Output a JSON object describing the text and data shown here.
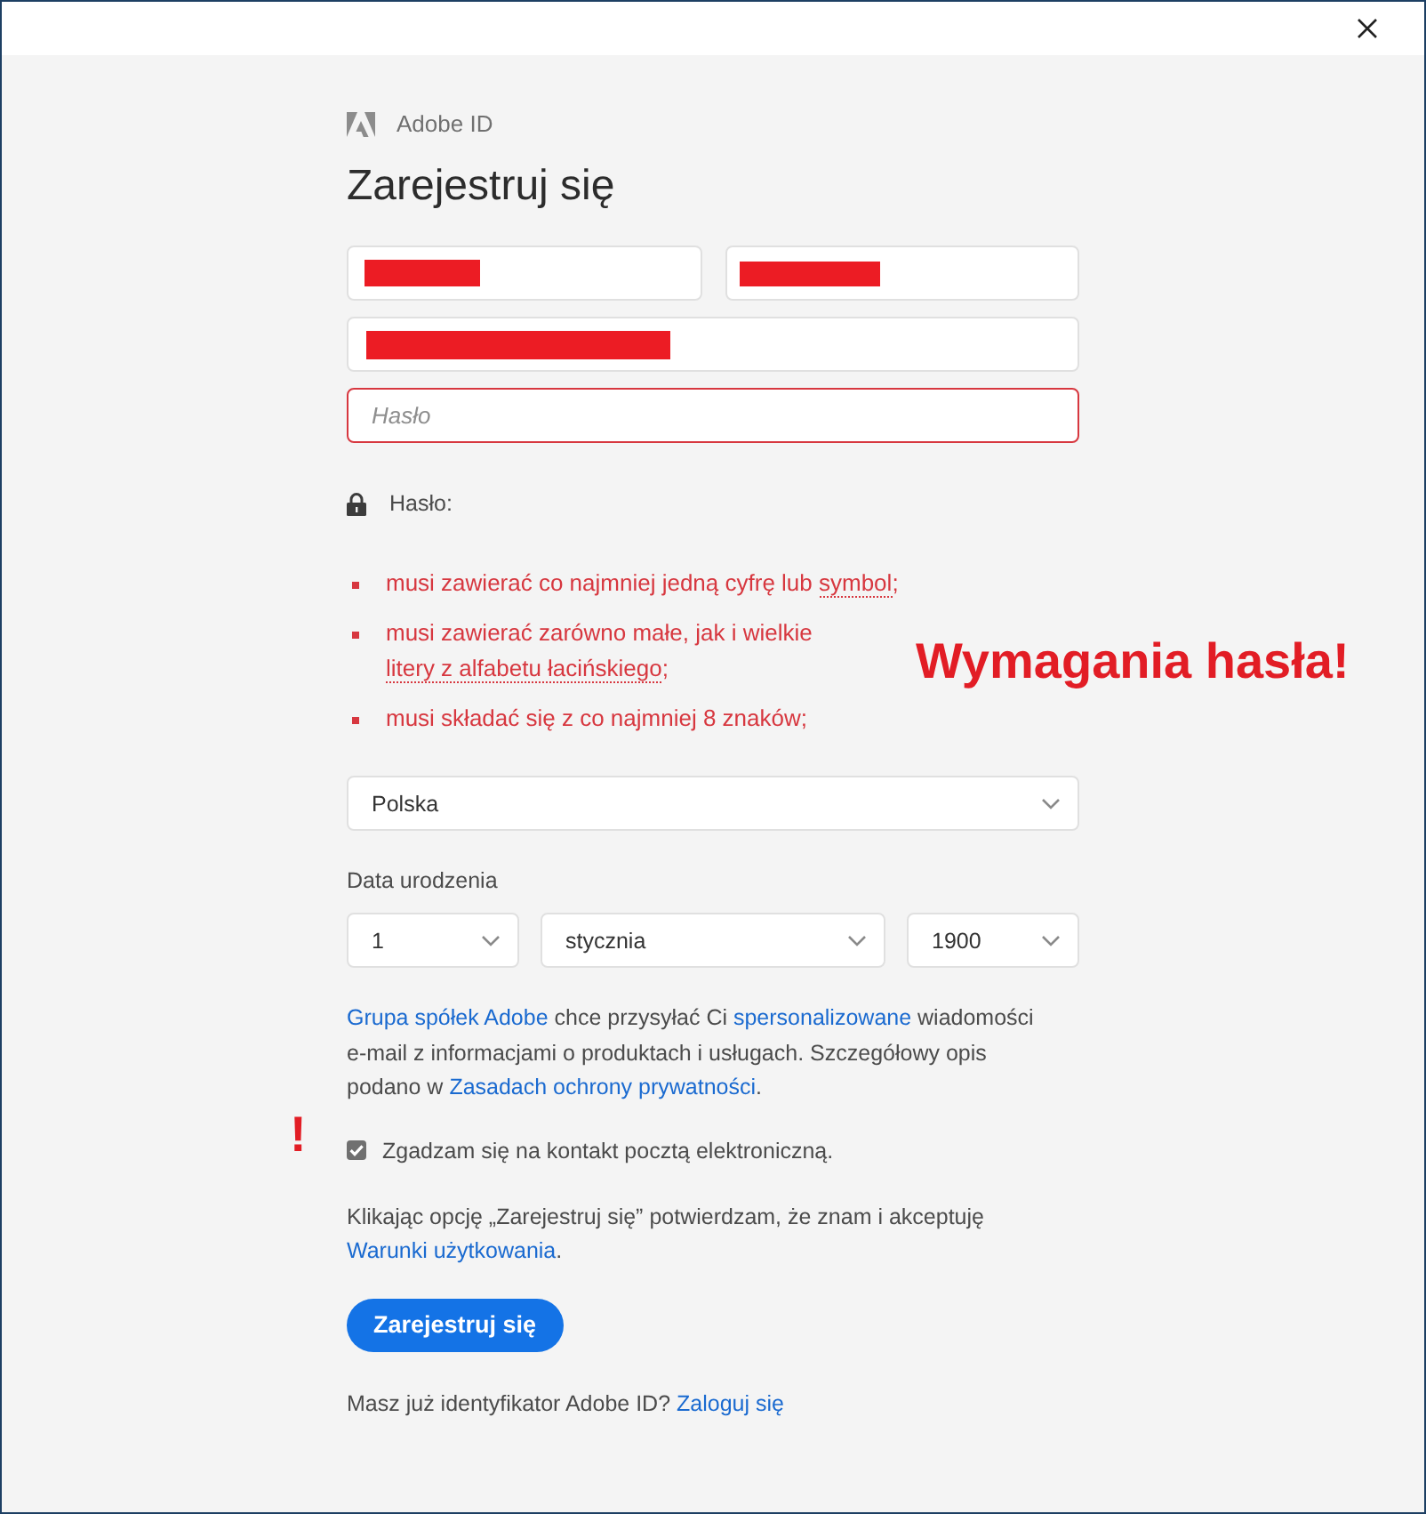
{
  "brand": {
    "name": "Adobe ID"
  },
  "title": "Zarejestruj się",
  "fields": [
    {
      "kind": "redacted"
    },
    {
      "kind": "redacted"
    },
    {
      "kind": "redacted"
    },
    {
      "kind": "password",
      "placeholder": "Hasło",
      "error": true
    }
  ],
  "password_rules": {
    "label": "Hasło:",
    "items": [
      {
        "met": false,
        "parts": [
          {
            "text": "musi zawierać co najmniej jedną cyfrę lub ",
            "term": false
          },
          {
            "text": "symbol",
            "term": true
          },
          {
            "text": ";",
            "term": false
          }
        ]
      },
      {
        "met": false,
        "parts": [
          {
            "text": "musi zawierać zarówno małe, jak i wielkie ",
            "term": false
          },
          {
            "text": "litery z alfabetu łacińskiego",
            "term": true
          },
          {
            "text": ";",
            "term": false
          }
        ]
      },
      {
        "met": false,
        "parts": [
          {
            "text": "musi składać się z co najmniej 8 znaków;",
            "term": false
          }
        ]
      }
    ]
  },
  "country": {
    "value": "Polska"
  },
  "birth_date": {
    "label": "Data urodzenia",
    "selects": [
      {
        "value": "1"
      },
      {
        "value": "stycznia"
      },
      {
        "value": "1900"
      }
    ]
  },
  "marketing": {
    "parts": [
      {
        "text": "Grupa spółek Adobe",
        "link": true
      },
      {
        "text": " chce przysyłać Ci ",
        "link": false
      },
      {
        "text": "spersonalizowane",
        "link": true
      },
      {
        "text": " wiadomości e-mail z informacjami o produktach i usługach. Szczegółowy opis podano w ",
        "link": false
      },
      {
        "text": "Zasadach ochrony prywatności",
        "link": true
      },
      {
        "text": ".",
        "link": false
      }
    ]
  },
  "consent": {
    "label": "Zgadzam się na kontakt pocztą elektroniczną.",
    "checked": true
  },
  "terms": {
    "parts": [
      {
        "text": "Klikając opcję „Zarejestruj się” potwierdzam, że znam i akceptuję ",
        "link": false
      },
      {
        "text": "Warunki użytkowania",
        "link": true
      },
      {
        "text": ".",
        "link": false
      }
    ]
  },
  "submit_button": "Zarejestruj się",
  "login_prompt": {
    "parts": [
      {
        "text": "Masz już identyfikator Adobe ID? ",
        "link": false
      },
      {
        "text": "Zaloguj się",
        "link": true
      }
    ]
  },
  "annotations": [
    {
      "kind": "callout",
      "text": "Wymagania hasła!"
    },
    {
      "kind": "mark",
      "text": "!"
    }
  ]
}
